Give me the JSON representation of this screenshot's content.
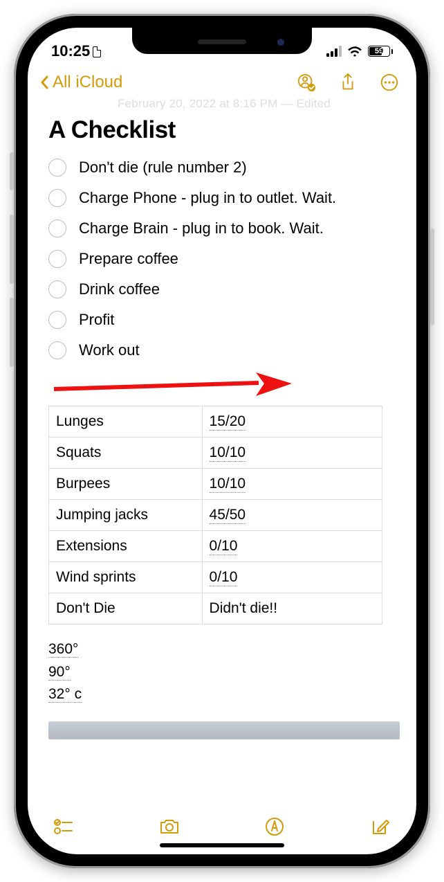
{
  "status": {
    "time": "10:25",
    "battery": "59"
  },
  "nav": {
    "back_label": "All iCloud"
  },
  "note": {
    "date_line": "February 20, 2022 at 8:16 PM — Edited",
    "title": "A Checklist",
    "checklist": [
      "Don't die (rule number 2)",
      "Charge Phone - plug in to outlet. Wait.",
      "Charge Brain - plug in to book. Wait.",
      "Prepare coffee",
      "Drink coffee",
      "Profit",
      "Work out"
    ],
    "table": [
      {
        "name": "Lunges",
        "val": "15/20"
      },
      {
        "name": "Squats",
        "val": "10/10"
      },
      {
        "name": "Burpees",
        "val": "10/10"
      },
      {
        "name": "Jumping jacks",
        "val": "45/50"
      },
      {
        "name": "Extensions",
        "val": "0/10"
      },
      {
        "name": "Wind sprints",
        "val": "0/10"
      },
      {
        "name": "Don't Die",
        "val": "Didn't die!!"
      }
    ],
    "degrees": [
      "360°",
      "90°",
      "32° c"
    ]
  }
}
